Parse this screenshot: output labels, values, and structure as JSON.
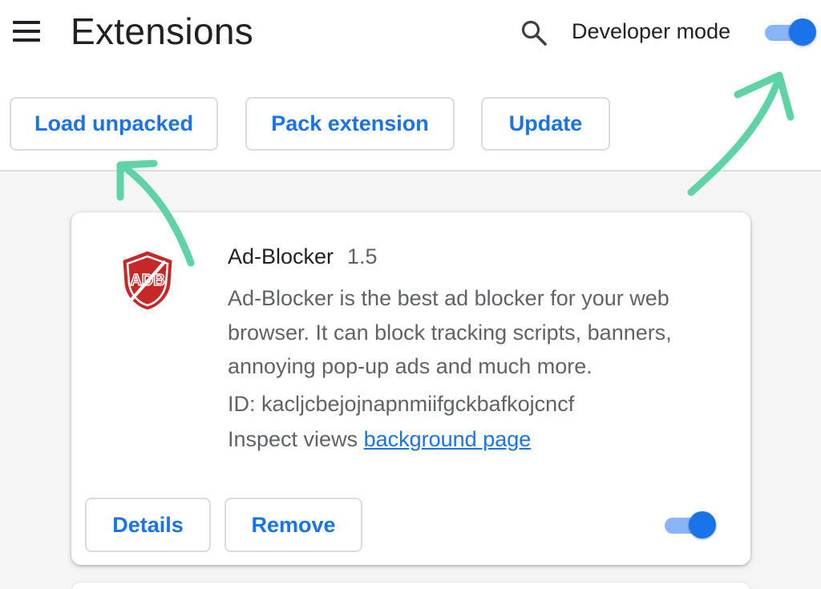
{
  "header": {
    "title": "Extensions",
    "menu_icon": "hamburger-menu-icon",
    "search_icon": "search-icon",
    "developer_mode_label": "Developer mode",
    "developer_mode_on": true
  },
  "toolbar": {
    "load_unpacked_label": "Load unpacked",
    "pack_extension_label": "Pack extension",
    "update_label": "Update"
  },
  "extension": {
    "icon": "adblock-shield-icon",
    "icon_text": "ADB",
    "name": "Ad-Blocker",
    "version": "1.5",
    "description": "Ad-Blocker is the best ad blocker for your web browser. It can block tracking scripts, banners, annoying pop-up ads and much more.",
    "id_text": "ID: kacljcbejojnapnmiifgckbafkojcncf",
    "inspect_views_label": "Inspect views",
    "background_page_link": "background page",
    "details_label": "Details",
    "remove_label": "Remove",
    "enabled": true
  },
  "colors": {
    "accent": "#1a73e8",
    "toggle_track": "#8ab4f8",
    "annotation_arrow": "#5fd3a6",
    "shield_red": "#c62828"
  }
}
